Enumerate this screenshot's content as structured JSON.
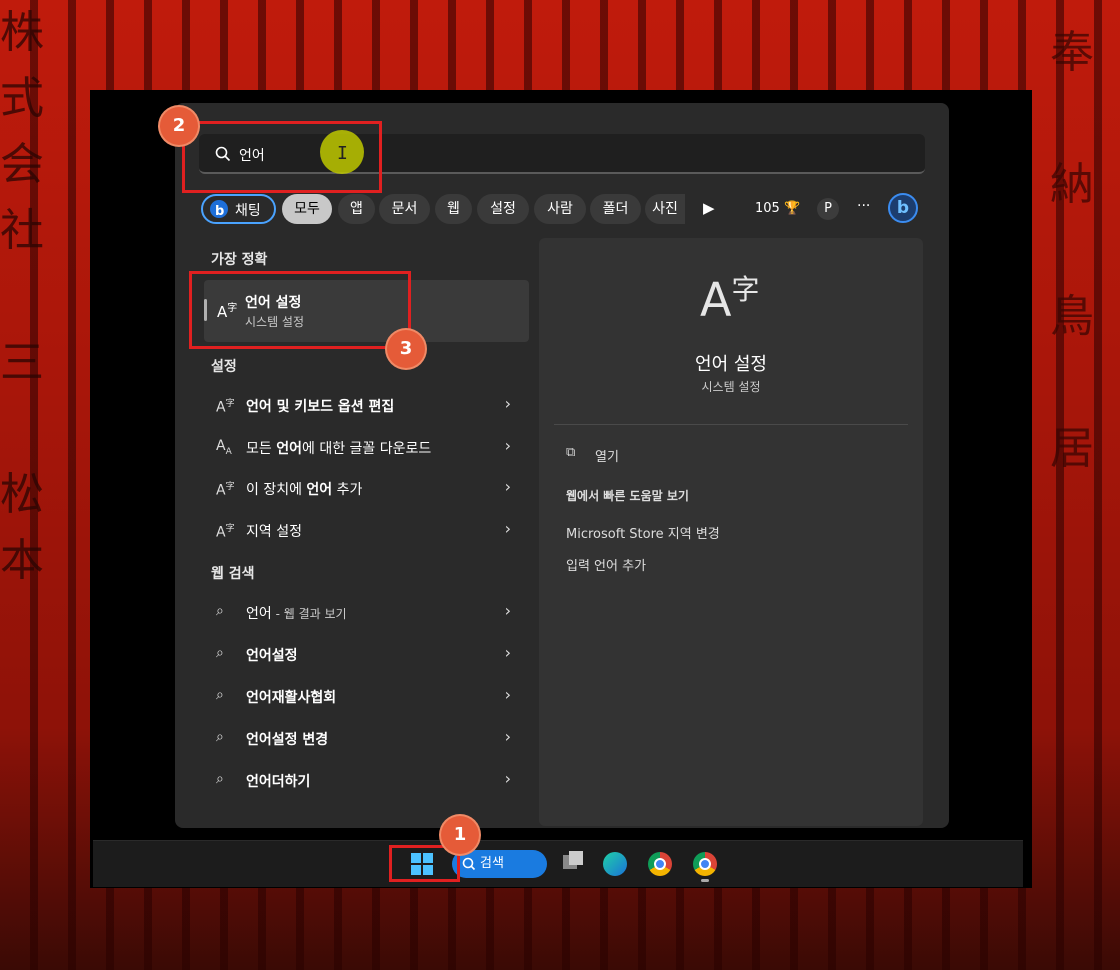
{
  "search": {
    "query": "언어"
  },
  "filters": {
    "chat": "채팅",
    "items": [
      "모두",
      "앱",
      "문서",
      "웹",
      "설정",
      "사람",
      "폴더",
      "사진"
    ],
    "count": "105",
    "profile": "P",
    "more": "···"
  },
  "best_match": {
    "heading": "가장 정확",
    "title": "언어 설정",
    "subtitle": "시스템 설정"
  },
  "settings": {
    "heading": "설정",
    "items": [
      {
        "label": "언어 및 키보드 옵션 편집"
      },
      {
        "label_normal": "모든 ",
        "label_bold": "언어",
        "label_rest": "에 대한 글꼴 다운로드"
      },
      {
        "label_normal": "이 장치에 ",
        "label_bold": "언어",
        "label_rest": " 추가"
      },
      {
        "label": "지역 설정"
      }
    ]
  },
  "web": {
    "heading": "웹 검색",
    "items": [
      {
        "label": "언어",
        "suffix": " - 웹 결과 보기"
      },
      {
        "label": "언어설정"
      },
      {
        "label": "언어재활사협회"
      },
      {
        "label": "언어설정 변경"
      },
      {
        "label": "언어더하기"
      }
    ]
  },
  "detail": {
    "title": "언어 설정",
    "subtitle": "시스템 설정",
    "open": "열기",
    "web_help": "웹에서 빠른 도움말 보기",
    "links": [
      "Microsoft Store 지역 변경",
      "입력 언어 추가"
    ]
  },
  "taskbar": {
    "search_label": "검색"
  },
  "badges": [
    "1",
    "2",
    "3"
  ],
  "colors": {
    "accent": "#4cc2ff",
    "highlight": "#e02020",
    "badge": "#e55b38"
  }
}
